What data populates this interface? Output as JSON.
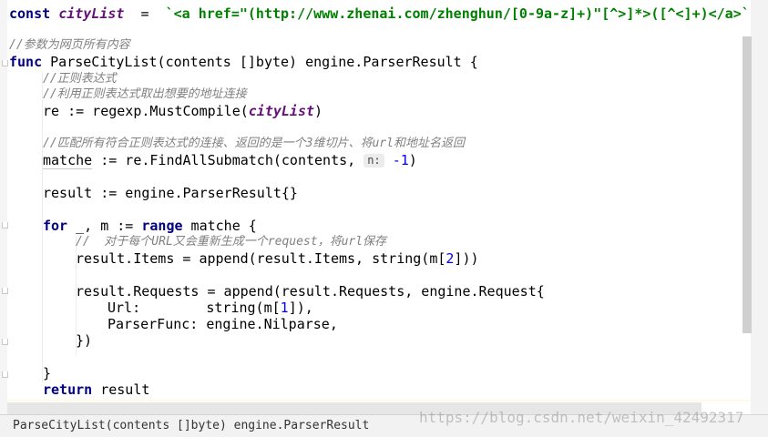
{
  "code": {
    "line1": {
      "kw": "const",
      "name": "cityList",
      "op": "  =  ",
      "str": "`<a href=\"(http://www.zhenai.com/zhenghun/[0-9a-z]+)\"[^>]*>([^<]+)</a>`"
    },
    "comment_params": "//参数为网页所有内容",
    "func_line": {
      "kw": "func",
      "rest": " ParseCityList(contents []byte) engine.ParserResult {"
    },
    "comment_regex": "//正则表达式",
    "comment_extract": "//利用正则表达式取出想要的地址连接",
    "re_line": {
      "prefix": "re := regexp.MustCompile(",
      "arg": "cityList",
      "suffix": ")"
    },
    "comment_match": "//匹配所有符合正则表达式的连接、返回的是一个3维切片、将url和地址名返回",
    "match_line": {
      "var": "matche",
      "mid": " := re.FindAllSubmatch(contents, ",
      "hint": "n:",
      "num": "-1",
      "end": ")"
    },
    "result_line": "result := engine.ParserResult{}",
    "for_line": {
      "kw1": "for",
      "mid": " _, m := ",
      "kw2": "range",
      "rest": " matche {"
    },
    "comment_each": "//  对于每个URL又会重新生成一个request，将url保存",
    "items_line": {
      "prefix": "result.Items = append(result.Items, string(m[",
      "num": "2",
      "suffix": "]))"
    },
    "requests_line": "result.Requests = append(result.Requests, engine.Request{",
    "url_line": {
      "prefix": "Url:        string(m[",
      "num": "1",
      "suffix": "]),"
    },
    "parser_line": "ParserFunc: engine.Nilparse,",
    "close_paren": "})",
    "close_brace": "}",
    "return_line": {
      "kw": "return",
      "rest": " result"
    }
  },
  "status_bar": {
    "text": "ParseCityList(contents []byte) engine.ParserResult"
  },
  "watermark": "https://blog.csdn.net/weixin_42492317"
}
